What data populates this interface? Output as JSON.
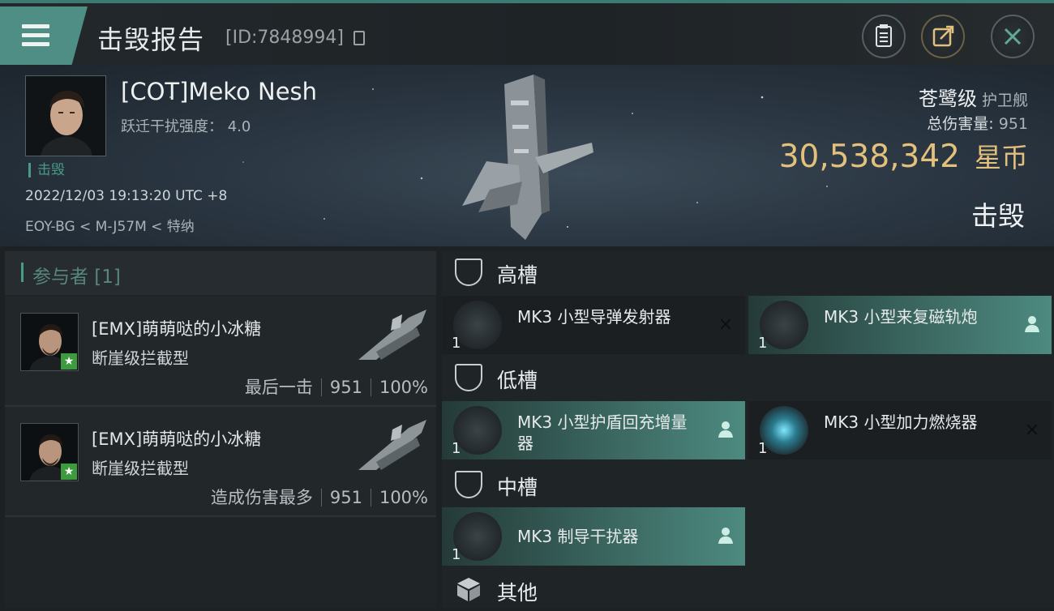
{
  "header": {
    "title": "击毁报告",
    "report_id": "[ID:7848994]"
  },
  "victim": {
    "pilot": "[COT]Meko Nesh",
    "warp_label": "跃迁干扰强度：",
    "warp_value": "4.0",
    "kill_tag": "击毁",
    "datetime": "2022/12/03 19:13:20 UTC +8",
    "location": "EOY-BG < M-J57M < 特纳",
    "ship_class": "苍鹭级",
    "ship_type": "护卫舰",
    "damage_label": "总伤害量:",
    "damage_value": "951",
    "isk_value": "30,538,342",
    "isk_unit": "星币",
    "status": "击毁"
  },
  "participants": {
    "header": "参与者 [1]",
    "items": [
      {
        "name": "[EMX]萌萌哒的小冰糖",
        "ship": "断崖级拦截型",
        "role": "最后一击",
        "damage": "951",
        "percent": "100%"
      },
      {
        "name": "[EMX]萌萌哒的小冰糖",
        "ship": "断崖级拦截型",
        "role": "造成伤害最多",
        "damage": "951",
        "percent": "100%"
      }
    ]
  },
  "fitting": {
    "high": {
      "label": "高槽",
      "items": [
        {
          "qty": "1",
          "name": "MK3 小型导弹发射器",
          "state": "destroyed",
          "icon": "missile-launcher-icon"
        },
        {
          "qty": "1",
          "name": "MK3 小型来复磁轨炮",
          "state": "dropped",
          "icon": "railgun-icon"
        }
      ]
    },
    "low": {
      "label": "低槽",
      "items": [
        {
          "qty": "1",
          "name": "MK3 小型护盾回充增量器",
          "state": "dropped",
          "icon": "shield-recharger-icon"
        },
        {
          "qty": "1",
          "name": "MK3 小型加力燃烧器",
          "state": "destroyed",
          "icon": "afterburner-icon"
        }
      ]
    },
    "mid": {
      "label": "中槽",
      "items": [
        {
          "qty": "1",
          "name": "MK3 制导干扰器",
          "state": "dropped",
          "icon": "guidance-disruptor-icon"
        }
      ]
    },
    "other": {
      "label": "其他"
    }
  },
  "icons": {
    "destroyed": "×",
    "dropped": "person-icon"
  },
  "colors": {
    "accent": "#4f8e84",
    "isk": "#e3c07b",
    "kill_tag": "#4a9a86"
  }
}
